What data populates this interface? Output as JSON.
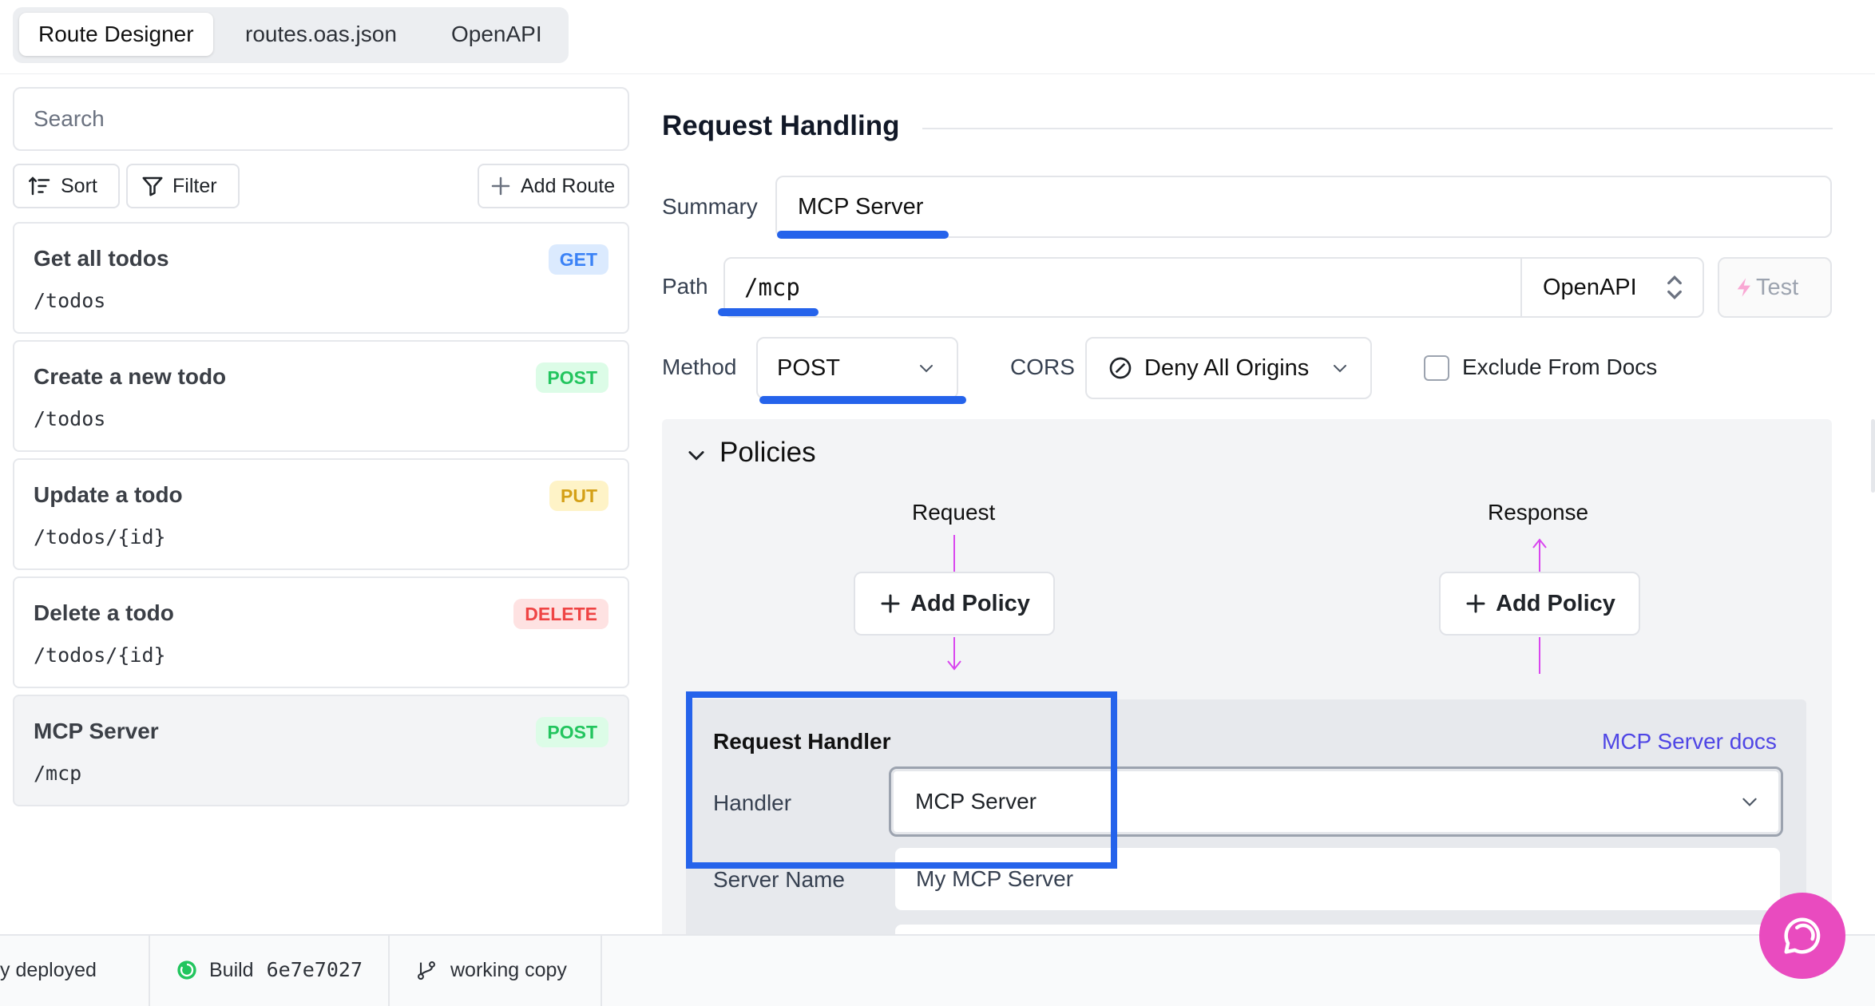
{
  "tabs": [
    {
      "label": "Route Designer",
      "active": true
    },
    {
      "label": "routes.oas.json",
      "active": false
    },
    {
      "label": "OpenAPI",
      "active": false
    }
  ],
  "sidebar": {
    "search_placeholder": "Search",
    "sort_label": "Sort",
    "filter_label": "Filter",
    "add_route_label": "Add Route",
    "routes": [
      {
        "title": "Get all todos",
        "path": "/todos",
        "method": "GET"
      },
      {
        "title": "Create a new todo",
        "path": "/todos",
        "method": "POST"
      },
      {
        "title": "Update a todo",
        "path": "/todos/{id}",
        "method": "PUT"
      },
      {
        "title": "Delete a todo",
        "path": "/todos/{id}",
        "method": "DELETE"
      },
      {
        "title": "MCP Server",
        "path": "/mcp",
        "method": "POST"
      }
    ]
  },
  "request_handling": {
    "title": "Request Handling",
    "summary_label": "Summary",
    "summary_value": "MCP Server",
    "path_label": "Path",
    "path_value": "/mcp",
    "path_format": "OpenAPI",
    "test_label": "Test",
    "method_label": "Method",
    "method_value": "POST",
    "cors_label": "CORS",
    "cors_value": "Deny All Origins",
    "exclude_label": "Exclude From Docs"
  },
  "policies": {
    "title": "Policies",
    "request_label": "Request",
    "response_label": "Response",
    "add_policy_label": "Add Policy"
  },
  "handler": {
    "title": "Request Handler",
    "docs_link": "MCP Server docs",
    "handler_label": "Handler",
    "handler_value": "MCP Server",
    "server_name_label": "Server Name",
    "server_name_value": "My MCP Server"
  },
  "status_bar": {
    "deploy_text": "y deployed",
    "build_label": "Build",
    "build_hash": "6e7e7027",
    "branch": "working copy"
  },
  "colors": {
    "accent": "#2563eb",
    "policy_arrow": "#d946ef",
    "chat": "#e94bbf",
    "link": "#4f46e5"
  }
}
